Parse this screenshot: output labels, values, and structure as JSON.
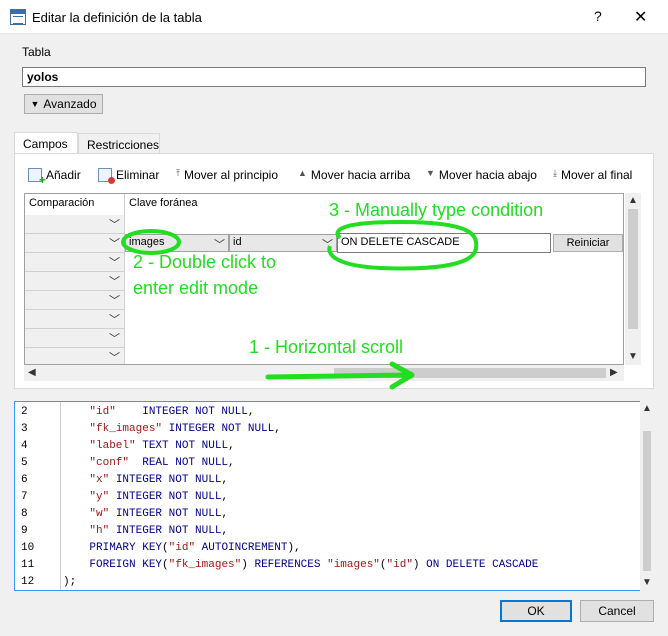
{
  "window": {
    "title": "Editar la definición de la tabla",
    "help_glyph": "?",
    "close_glyph": "✕"
  },
  "table": {
    "label": "Tabla",
    "name": "yolos",
    "advanced_label": "Avanzado"
  },
  "tabs": [
    {
      "label": "Campos"
    },
    {
      "label": "Restricciones"
    }
  ],
  "toolbar": {
    "add": "Añadir",
    "remove": "Eliminar",
    "move_top": "Mover al principio",
    "move_up": "Mover hacia arriba",
    "move_down": "Mover hacia abajo",
    "move_bottom": "Mover al final"
  },
  "grid": {
    "columns": [
      "Comparación",
      "Clave foránea"
    ],
    "fk_table": "images",
    "fk_column": "id",
    "fk_condition": "ON DELETE CASCADE",
    "reset_label": "Reiniciar"
  },
  "annotations": {
    "horizontal_scroll": "1 - Horizontal scroll",
    "double_click": "2 - Double click to enter edit mode",
    "type_condition": "3 - Manually type condition"
  },
  "code": {
    "lines": [
      {
        "n": "2",
        "parts": [
          [
            "s",
            "\"id\""
          ],
          [
            "t",
            "    "
          ],
          [
            "k",
            "INTEGER NOT NULL"
          ],
          [
            "t",
            ","
          ]
        ]
      },
      {
        "n": "3",
        "parts": [
          [
            "s",
            "\"fk_images\""
          ],
          [
            "t",
            " "
          ],
          [
            "k",
            "INTEGER NOT NULL"
          ],
          [
            "t",
            ","
          ]
        ]
      },
      {
        "n": "4",
        "parts": [
          [
            "s",
            "\"label\""
          ],
          [
            "t",
            " "
          ],
          [
            "k",
            "TEXT NOT NULL"
          ],
          [
            "t",
            ","
          ]
        ]
      },
      {
        "n": "5",
        "parts": [
          [
            "s",
            "\"conf\""
          ],
          [
            "t",
            "  "
          ],
          [
            "k",
            "REAL NOT NULL"
          ],
          [
            "t",
            ","
          ]
        ]
      },
      {
        "n": "6",
        "parts": [
          [
            "s",
            "\"x\""
          ],
          [
            "t",
            " "
          ],
          [
            "k",
            "INTEGER NOT NULL"
          ],
          [
            "t",
            ","
          ]
        ]
      },
      {
        "n": "7",
        "parts": [
          [
            "s",
            "\"y\""
          ],
          [
            "t",
            " "
          ],
          [
            "k",
            "INTEGER NOT NULL"
          ],
          [
            "t",
            ","
          ]
        ]
      },
      {
        "n": "8",
        "parts": [
          [
            "s",
            "\"w\""
          ],
          [
            "t",
            " "
          ],
          [
            "k",
            "INTEGER NOT NULL"
          ],
          [
            "t",
            ","
          ]
        ]
      },
      {
        "n": "9",
        "parts": [
          [
            "s",
            "\"h\""
          ],
          [
            "t",
            " "
          ],
          [
            "k",
            "INTEGER NOT NULL"
          ],
          [
            "t",
            ","
          ]
        ]
      },
      {
        "n": "10",
        "parts": [
          [
            "k",
            "PRIMARY KEY"
          ],
          [
            "t",
            "("
          ],
          [
            "s",
            "\"id\""
          ],
          [
            "t",
            " "
          ],
          [
            "k",
            "AUTOINCREMENT"
          ],
          [
            "t",
            "),"
          ]
        ]
      },
      {
        "n": "11",
        "parts": [
          [
            "k",
            "FOREIGN KEY"
          ],
          [
            "t",
            "("
          ],
          [
            "s",
            "\"fk_images\""
          ],
          [
            "t",
            ") "
          ],
          [
            "k",
            "REFERENCES"
          ],
          [
            "t",
            " "
          ],
          [
            "s",
            "\"images\""
          ],
          [
            "t",
            "("
          ],
          [
            "s",
            "\"id\""
          ],
          [
            "t",
            ") "
          ],
          [
            "k",
            "ON DELETE CASCADE"
          ]
        ]
      },
      {
        "n": "12",
        "parts": [
          [
            "t",
            ");"
          ]
        ]
      }
    ]
  },
  "footer": {
    "ok": "OK",
    "cancel": "Cancel"
  }
}
